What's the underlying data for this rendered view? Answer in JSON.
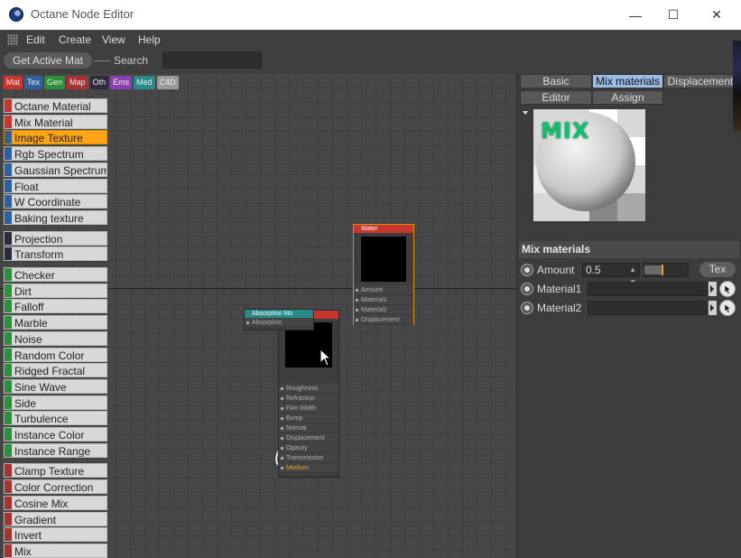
{
  "window": {
    "title": "Octane Node Editor",
    "minimize_glyph": "—",
    "maximize_glyph": "☐",
    "close_glyph": "✕"
  },
  "menu": [
    "Edit",
    "Create",
    "View",
    "Help"
  ],
  "toolbar": {
    "get_active_mat": "Get Active Mat",
    "search_label": "Search",
    "search_value": ""
  },
  "categories": [
    {
      "label": "Mat",
      "color": "#c8372f"
    },
    {
      "label": "Tex",
      "color": "#2f5f9f"
    },
    {
      "label": "Gen",
      "color": "#2e8f3a"
    },
    {
      "label": "Map",
      "color": "#a83232"
    },
    {
      "label": "Oth",
      "color": "#2b2b3a"
    },
    {
      "label": "Ems",
      "color": "#8a3fb0"
    },
    {
      "label": "Med",
      "color": "#2a8a8a"
    },
    {
      "label": "C4D",
      "color": "#9a9a9a"
    }
  ],
  "node_list": [
    {
      "label": "Octane Material",
      "color": "#c8372f"
    },
    {
      "label": "Mix Material",
      "color": "#c8372f"
    },
    {
      "label": "Image Texture",
      "color": "#2f5f9f",
      "selected": true
    },
    {
      "label": "Rgb Spectrum",
      "color": "#2f5f9f"
    },
    {
      "label": "Gaussian Spectrum",
      "color": "#2f5f9f"
    },
    {
      "label": "Float",
      "color": "#2f5f9f"
    },
    {
      "label": "W Coordinate",
      "color": "#2f5f9f"
    },
    {
      "label": "Baking texture",
      "color": "#2f5f9f"
    },
    {
      "label": "Projection",
      "color": "#2b2b3a"
    },
    {
      "label": "Transform",
      "color": "#2b2b3a"
    },
    {
      "label": "Checker",
      "color": "#2e8f3a"
    },
    {
      "label": "Dirt",
      "color": "#2e8f3a"
    },
    {
      "label": "Falloff",
      "color": "#2e8f3a"
    },
    {
      "label": "Marble",
      "color": "#2e8f3a"
    },
    {
      "label": "Noise",
      "color": "#2e8f3a"
    },
    {
      "label": "Random Color",
      "color": "#2e8f3a"
    },
    {
      "label": "Ridged Fractal",
      "color": "#2e8f3a"
    },
    {
      "label": "Sine Wave",
      "color": "#2e8f3a"
    },
    {
      "label": "Side",
      "color": "#2e8f3a"
    },
    {
      "label": "Turbulence",
      "color": "#2e8f3a"
    },
    {
      "label": "Instance Color",
      "color": "#2e8f3a"
    },
    {
      "label": "Instance Range",
      "color": "#2e8f3a"
    },
    {
      "label": "Clamp Texture",
      "color": "#a83232"
    },
    {
      "label": "Color Correction",
      "color": "#a83232"
    },
    {
      "label": "Cosine Mix",
      "color": "#a83232"
    },
    {
      "label": "Gradient",
      "color": "#a83232"
    },
    {
      "label": "Invert",
      "color": "#a83232"
    },
    {
      "label": "Mix",
      "color": "#a83232"
    }
  ],
  "graph": {
    "mix_node": {
      "title": "Water",
      "pins": [
        "Amount",
        "Material1",
        "Material2",
        "Displacement"
      ]
    },
    "absorption_node": {
      "title": "Absorption Mo",
      "pins": [
        "Absorption"
      ]
    },
    "material_node": {
      "pins": [
        "Roughness",
        "Refraction",
        "Film Width",
        "Bump",
        "Normal",
        "Displacement",
        "Opacity",
        "Transmission",
        "Medium"
      ]
    }
  },
  "panel": {
    "tabs_row1": [
      "Basic",
      "Mix materials",
      "Displacement"
    ],
    "tabs_row2": [
      "Editor",
      "Assign"
    ],
    "active_tab": "Mix materials",
    "preview_label": "MIX",
    "section_title": "Mix materials",
    "amount": {
      "label": "Amount",
      "value": "0.5",
      "slider_fraction": 0.5,
      "tex_button": "Tex"
    },
    "material1": {
      "label": "Material1",
      "value": ""
    },
    "material2": {
      "label": "Material2",
      "value": ""
    }
  }
}
